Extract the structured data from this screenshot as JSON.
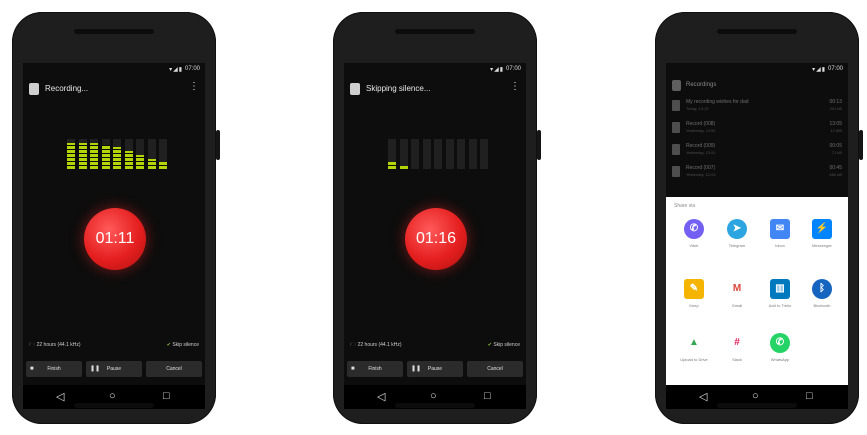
{
  "phones": [
    {
      "status_time": "07:00",
      "title": "Recording...",
      "menu_glyph": "⋮",
      "timer": "01:11",
      "quality": "22 hours (44.1 kHz)",
      "skip_silence": "Skip silence",
      "buttons": [
        "Finish",
        "Pause",
        "Cancel"
      ]
    },
    {
      "status_time": "07:00",
      "title": "Skipping silence...",
      "menu_glyph": "⋮",
      "timer": "01:16",
      "quality": "22 hours (44.1 kHz)",
      "skip_silence": "Skip silence",
      "buttons": [
        "Finish",
        "Pause",
        "Cancel"
      ]
    },
    {
      "status_time": "07:00",
      "title": "Recordings",
      "recordings": [
        {
          "name": "My recording wishes for dad",
          "date": "Today, 14:12",
          "duration": "00:13",
          "size": "201 kB"
        },
        {
          "name": "Record (008)",
          "date": "Yesterday, 13:52",
          "duration": "13:05",
          "size": "12 MB"
        },
        {
          "name": "Record (009)",
          "date": "Yesterday, 13:51",
          "duration": "00:05",
          "size": "71 kB"
        },
        {
          "name": "Record (007)",
          "date": "Yesterday, 12:03",
          "duration": "00:45",
          "size": "660 kB"
        }
      ],
      "share_label": "Share via",
      "apps": [
        {
          "name": "Viber",
          "icon": "viber-icon",
          "color": "#7360f2",
          "glyph": "✆"
        },
        {
          "name": "Telegram",
          "icon": "telegram-icon",
          "color": "#2ca5e0",
          "glyph": "➤"
        },
        {
          "name": "Inbox",
          "icon": "inbox-icon",
          "color": "#4285f4",
          "glyph": "✉"
        },
        {
          "name": "Messenger",
          "icon": "messenger-icon",
          "color": "#0084ff",
          "glyph": "⚡"
        },
        {
          "name": "Keep",
          "icon": "keep-icon",
          "color": "#f4b400",
          "glyph": "✎"
        },
        {
          "name": "Gmail",
          "icon": "gmail-icon",
          "color": "#db4437",
          "glyph": "M"
        },
        {
          "name": "Add to Trello",
          "icon": "trello-icon",
          "color": "#0079bf",
          "glyph": "▥"
        },
        {
          "name": "Bluetooth",
          "icon": "bluetooth-icon",
          "color": "#1565c0",
          "glyph": "ᛒ"
        },
        {
          "name": "Upload to Drive",
          "icon": "drive-icon",
          "color": "#34a853",
          "glyph": "▲"
        },
        {
          "name": "Slack",
          "icon": "slack-icon",
          "color": "#4a154b",
          "glyph": "#"
        },
        {
          "name": "WhatsApp",
          "icon": "whatsapp-icon",
          "color": "#25d366",
          "glyph": "✆"
        }
      ]
    }
  ],
  "colors": {
    "accent_red": "#e51f1f",
    "vu_green": "#b4d40a",
    "screen_bg": "#0d0d0d"
  },
  "levels_phone1": [
    0.85,
    0.85,
    0.85,
    0.8,
    0.72,
    0.6,
    0.45,
    0.32,
    0.22
  ],
  "levels_phone2": [
    0.22,
    0.1,
    0,
    0,
    0,
    0,
    0,
    0,
    0
  ]
}
